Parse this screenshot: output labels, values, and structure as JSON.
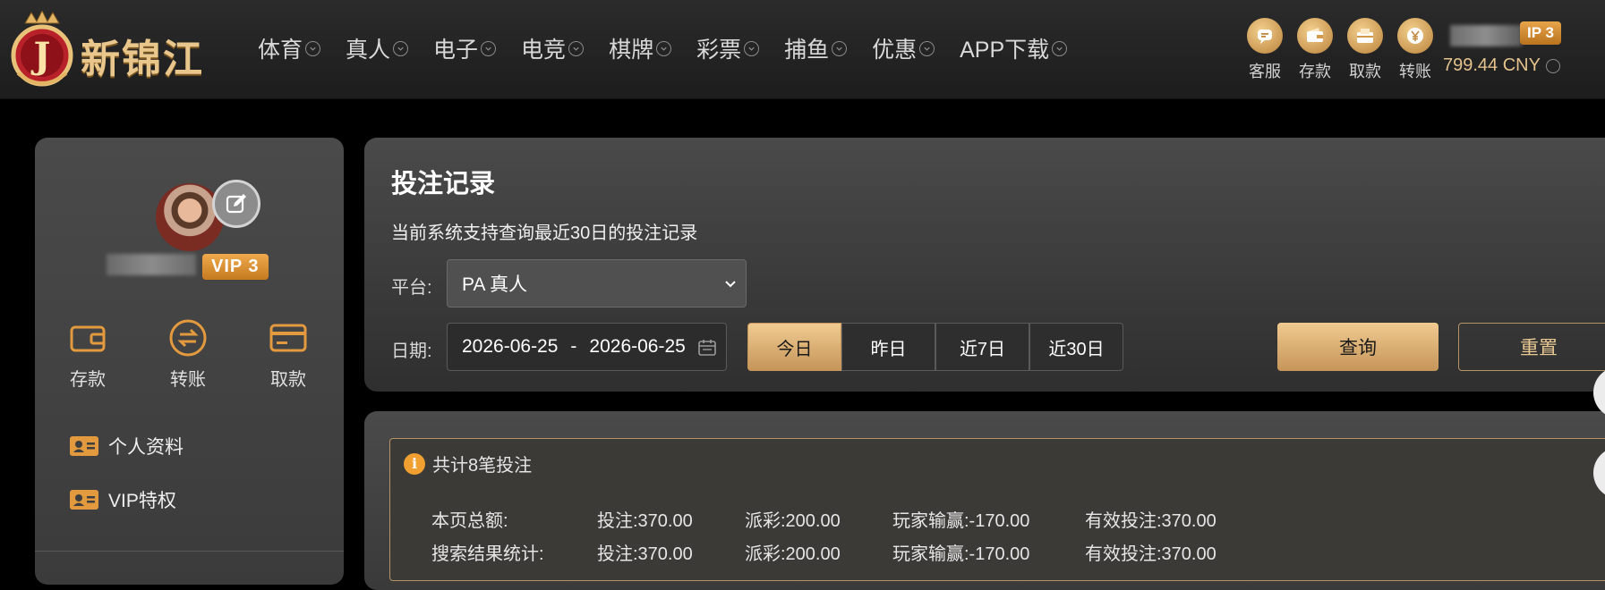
{
  "brand": {
    "logo_letter": "J",
    "name": "新锦江"
  },
  "nav": [
    {
      "label": "体育"
    },
    {
      "label": "真人"
    },
    {
      "label": "电子"
    },
    {
      "label": "电竞"
    },
    {
      "label": "棋牌"
    },
    {
      "label": "彩票"
    },
    {
      "label": "捕鱼"
    },
    {
      "label": "优惠"
    },
    {
      "label": "APP下载"
    }
  ],
  "tools": [
    {
      "label": "客服",
      "icon": "chat-icon"
    },
    {
      "label": "存款",
      "icon": "wallet-icon"
    },
    {
      "label": "取款",
      "icon": "atm-icon"
    },
    {
      "label": "转账",
      "icon": "yuan-transfer-icon"
    }
  ],
  "account": {
    "vip": "VIP 3",
    "vip_partial": "IP 3",
    "balance": "799.44 CNY"
  },
  "sidebar": {
    "vip": "VIP 3",
    "quick_actions": [
      {
        "label": "存款",
        "icon": "wallet-icon"
      },
      {
        "label": "转账",
        "icon": "transfer-icon"
      },
      {
        "label": "取款",
        "icon": "card-icon"
      }
    ],
    "menu": [
      {
        "label": "个人资料",
        "icon": "id-card-icon"
      },
      {
        "label": "VIP特权",
        "icon": "id-card-icon"
      }
    ]
  },
  "bet_records": {
    "title": "投注记录",
    "subtitle": "当前系统支持查询最近30日的投注记录",
    "platform_label": "平台:",
    "platform_value": "PA 真人",
    "date_label": "日期:",
    "date_from": "2026-06-25",
    "date_sep": "-",
    "date_to": "2026-06-25",
    "quick_ranges": [
      "今日",
      "昨日",
      "近7日",
      "近30日"
    ],
    "active_range": "今日",
    "query_button": "查询",
    "reset_button": "重置"
  },
  "summary": {
    "count_text": "共计8笔投注",
    "rows": [
      {
        "label": "本页总额:",
        "bet": "投注:370.00",
        "payout": "派彩:200.00",
        "win_loss": "玩家输赢:-170.00",
        "valid": "有效投注:370.00"
      },
      {
        "label": "搜索结果统计:",
        "bet": "投注:370.00",
        "payout": "派彩:200.00",
        "win_loss": "玩家输赢:-170.00",
        "valid": "有效投注:370.00"
      }
    ]
  },
  "colors": {
    "gold": "#e9c78c",
    "gold_button": "#d9ad72",
    "vip_orange": "#e39a3f"
  }
}
